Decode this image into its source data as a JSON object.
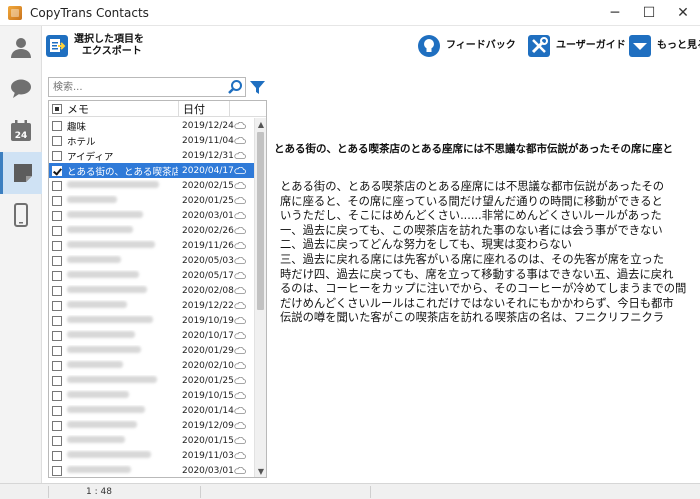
{
  "window": {
    "title": "CopyTrans Contacts",
    "controls": [
      "─",
      "☐",
      "✕"
    ]
  },
  "nav": {
    "items": [
      {
        "icon": "person-icon",
        "active": false
      },
      {
        "icon": "chat-bubble-icon",
        "active": false
      },
      {
        "icon": "calendar-icon",
        "label": "24",
        "active": false
      },
      {
        "icon": "notes-icon",
        "active": true
      },
      {
        "icon": "phone-icon",
        "active": false
      }
    ]
  },
  "toolbar": {
    "export_line1": "選択した項目を",
    "export_line2": "エクスポート",
    "feedback": "フィードバック",
    "guide": "ユーザーガイド",
    "more": "もっと見る"
  },
  "search": {
    "placeholder": "検索..."
  },
  "list": {
    "header_name": "メモ",
    "header_date": "日付",
    "rows": [
      {
        "name": "趣味",
        "date": "2019/12/24",
        "blurred": false,
        "selected": false
      },
      {
        "name": "ホテル",
        "date": "2019/11/04",
        "blurred": false,
        "selected": false
      },
      {
        "name": "アイディア",
        "date": "2019/12/31",
        "blurred": false,
        "selected": false
      },
      {
        "name": "とある街の、とある喫茶店...",
        "date": "2020/04/17",
        "blurred": false,
        "selected": true
      },
      {
        "name": "",
        "date": "2020/02/15",
        "blurred": true,
        "selected": false
      },
      {
        "name": "",
        "date": "2020/01/25",
        "blurred": true,
        "selected": false
      },
      {
        "name": "",
        "date": "2020/03/01",
        "blurred": true,
        "selected": false
      },
      {
        "name": "",
        "date": "2020/02/26",
        "blurred": true,
        "selected": false
      },
      {
        "name": "",
        "date": "2019/11/26",
        "blurred": true,
        "selected": false
      },
      {
        "name": "",
        "date": "2020/05/03",
        "blurred": true,
        "selected": false
      },
      {
        "name": "",
        "date": "2020/05/17",
        "blurred": true,
        "selected": false
      },
      {
        "name": "",
        "date": "2020/02/08",
        "blurred": true,
        "selected": false
      },
      {
        "name": "",
        "date": "2019/12/22",
        "blurred": true,
        "selected": false
      },
      {
        "name": "",
        "date": "2019/10/19",
        "blurred": true,
        "selected": false
      },
      {
        "name": "",
        "date": "2020/10/17",
        "blurred": true,
        "selected": false
      },
      {
        "name": "",
        "date": "2020/01/29",
        "blurred": true,
        "selected": false
      },
      {
        "name": "",
        "date": "2020/02/10",
        "blurred": true,
        "selected": false
      },
      {
        "name": "",
        "date": "2020/01/25",
        "blurred": true,
        "selected": false
      },
      {
        "name": "",
        "date": "2019/10/15",
        "blurred": true,
        "selected": false
      },
      {
        "name": "",
        "date": "2020/01/14",
        "blurred": true,
        "selected": false
      },
      {
        "name": "",
        "date": "2019/12/09",
        "blurred": true,
        "selected": false
      },
      {
        "name": "",
        "date": "2020/01/15",
        "blurred": true,
        "selected": false
      },
      {
        "name": "",
        "date": "2019/11/03",
        "blurred": true,
        "selected": false
      },
      {
        "name": "",
        "date": "2020/03/01",
        "blurred": true,
        "selected": false
      }
    ]
  },
  "detail": {
    "title": "とある街の、とある喫茶店のとある座席には不思議な都市伝説があったその席に座と",
    "body": "とある街の、とある喫茶店のとある座席には不思議な都市伝説があったその\n席に座ると、その席に座っている間だけ望んだ通りの時間に移動ができると\nいうただし、そこにはめんどくさい......非常にめんどくさいルールがあった\n一、過去に戻っても、この喫茶店を訪れた事のない者には会う事ができない\n二、過去に戻ってどんな努力をしても、現実は変わらない\n三、過去に戻れる席には先客がいる席に座れるのは、その先客が席を立った\n時だけ四、過去に戻っても、席を立って移動する事はできない五、過去に戻れ\nるのは、コーヒーをカップに注いでから、そのコーヒーが冷めてしまうまでの間\nだけめんどくさいルールはこれだけではないそれにもかかわらず、今日も都市\n伝説の噂を聞いた客がこの喫茶店を訪れる喫茶店の名は、フニクリフニクラ"
  },
  "status": {
    "time": "1 : 48"
  },
  "colors": {
    "accent": "#2f7ad8",
    "nav_active": "#cfe2f4",
    "export_icon": "#1f6fc0"
  }
}
